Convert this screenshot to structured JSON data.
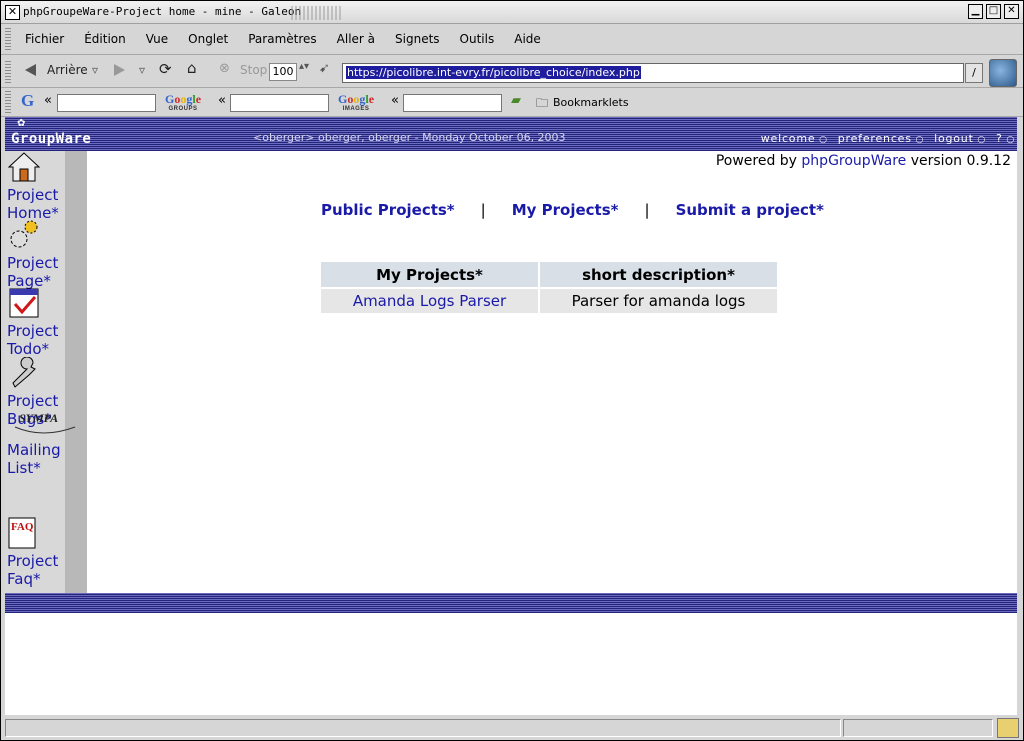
{
  "window": {
    "title": "phpGroupeWare-Project home - mine - Galeon"
  },
  "menu": [
    "Fichier",
    "Édition",
    "Vue",
    "Onglet",
    "Paramètres",
    "Aller à",
    "Signets",
    "Outils",
    "Aide"
  ],
  "toolbar": {
    "back_label": "Arrière",
    "stop_label": "Stop",
    "zoom": "100",
    "url": "https://picolibre.int-evry.fr/picolibre_choice/index.php"
  },
  "searchbar": {
    "groups_label": "GROUPS",
    "images_label": "IMAGES",
    "bookmarklets_label": "Bookmarklets"
  },
  "header": {
    "logo": "GroupWare",
    "userline": "<oberger> oberger, oberger - Monday October 06, 2003",
    "links": [
      "welcome",
      "preferences",
      "logout",
      "?"
    ]
  },
  "powered": {
    "prefix": "Powered by",
    "link": "phpGroupWare",
    "suffix": "version 0.9.12"
  },
  "sidebar": [
    {
      "line1": "Project",
      "line2": "Home*"
    },
    {
      "line1": "Project",
      "line2": "Page*"
    },
    {
      "line1": "Project",
      "line2": "Todo*"
    },
    {
      "line1": "Project",
      "line2": "Bugs*"
    },
    {
      "line1": "Mailing",
      "line2": "List*"
    },
    {
      "line1": "Project",
      "line2": "Faq*"
    }
  ],
  "nav": {
    "public": "Public Projects*",
    "mine": "My Projects*",
    "submit": "Submit a project*",
    "separator": "|"
  },
  "table": {
    "headers": [
      "My Projects*",
      "short description*"
    ],
    "rows": [
      {
        "name": "Amanda Logs Parser",
        "description": "Parser for amanda logs"
      }
    ]
  },
  "sympa_label": "SYMPA",
  "faq_letters": "FAQ"
}
